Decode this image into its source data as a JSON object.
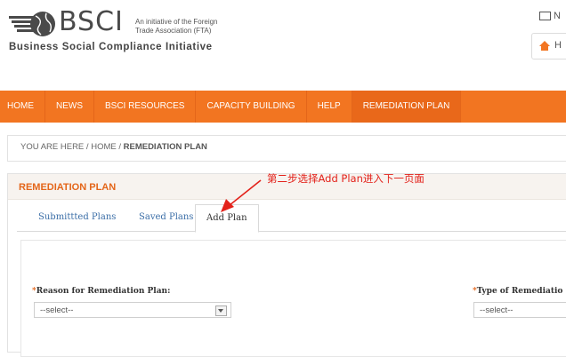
{
  "header": {
    "logo_word": "BSCI",
    "logo_tagline_1": "An initiative of the Foreign",
    "logo_tagline_2": "Trade Association (FTA)",
    "logo_subtitle": "Business Social Compliance Initiative",
    "mail_label": "N",
    "home_label": "H"
  },
  "nav": {
    "items": [
      "HOME",
      "NEWS",
      "BSCI RESOURCES",
      "CAPACITY BUILDING",
      "HELP",
      "REMEDIATION PLAN"
    ]
  },
  "breadcrumb": {
    "prefix": "YOU ARE HERE",
    "home": "HOME",
    "current": "REMEDIATION PLAN"
  },
  "panel": {
    "title": "REMEDIATION PLAN",
    "tabs": [
      "Submittted Plans",
      "Saved Plans",
      "Add Plan"
    ],
    "active_tab": "Add Plan"
  },
  "form": {
    "reason_label": "Reason for Remediation Plan:",
    "reason_value": "--select--",
    "type_label": "Type of Remediatio",
    "type_value": "--select--"
  },
  "annotation": {
    "text": "第二步选择Add Plan进入下一页面",
    "color": "#e3221b"
  },
  "colors": {
    "brand_orange": "#f27521",
    "link_blue": "#3b6ea7"
  }
}
